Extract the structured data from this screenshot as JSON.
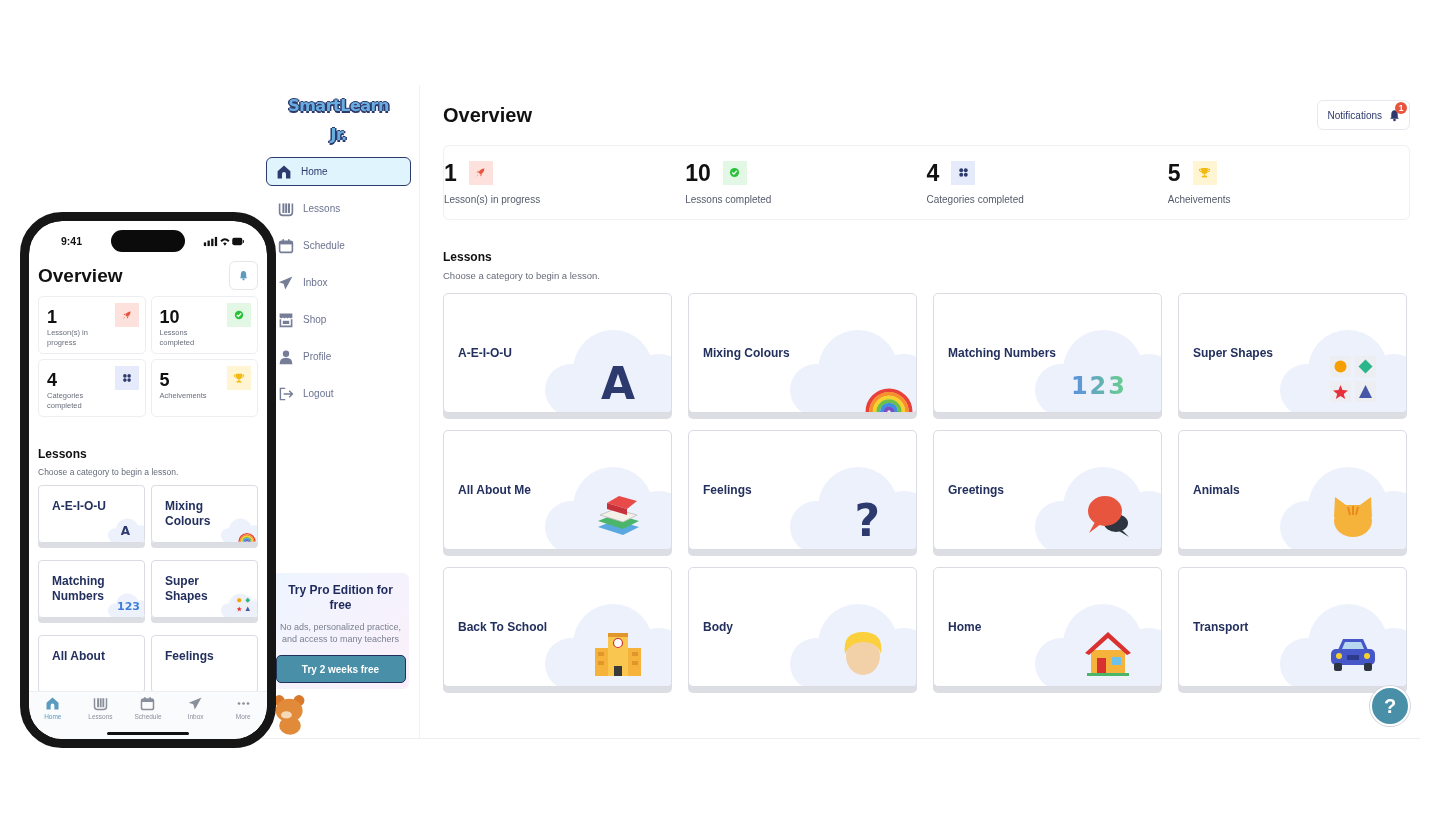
{
  "app": {
    "logo": "SmartLearn Jr.",
    "sidebar": {
      "items": [
        {
          "label": "Home",
          "kind": "home",
          "selected": true
        },
        {
          "label": "Lessons",
          "kind": "book",
          "selected": false
        },
        {
          "label": "Schedule",
          "kind": "calendar",
          "selected": false
        },
        {
          "label": "Inbox",
          "kind": "plane",
          "selected": false
        },
        {
          "label": "Shop",
          "kind": "shop",
          "selected": false
        },
        {
          "label": "Profile",
          "kind": "person",
          "selected": false
        },
        {
          "label": "Logout",
          "kind": "logout",
          "selected": false
        }
      ]
    },
    "promo": {
      "title": "Try Pro Edition for free",
      "text": "No ads, personalized practice, and access to many teachers",
      "button": "Try 2 weeks free"
    },
    "title": "Overview",
    "notifications": {
      "label": "Notifications",
      "badge": "1"
    },
    "stats": [
      {
        "value": "1",
        "label": "Lesson(s) in progress",
        "kind": "rocket"
      },
      {
        "value": "10",
        "label": "Lessons completed",
        "kind": "check"
      },
      {
        "value": "4",
        "label": "Categories completed",
        "kind": "grid"
      },
      {
        "value": "5",
        "label": "Acheivements",
        "kind": "trophy"
      }
    ],
    "lessons": {
      "heading": "Lessons",
      "subtitle": "Choose a category to begin a lesson.",
      "cards": [
        {
          "title": "A-E-I-O-U",
          "kind": "letter",
          "glyph": "A"
        },
        {
          "title": "Mixing Colours",
          "kind": "rainbow"
        },
        {
          "title": "Matching Numbers",
          "kind": "numbers",
          "glyph": "123"
        },
        {
          "title": "Super Shapes",
          "kind": "shapes"
        },
        {
          "title": "All About Me",
          "kind": "books"
        },
        {
          "title": "Feelings",
          "kind": "question",
          "glyph": "?"
        },
        {
          "title": "Greetings",
          "kind": "speech"
        },
        {
          "title": "Animals",
          "kind": "cat"
        },
        {
          "title": "Back To School",
          "kind": "school"
        },
        {
          "title": "Body",
          "kind": "person"
        },
        {
          "title": "Home",
          "kind": "house"
        },
        {
          "title": "Transport",
          "kind": "car"
        }
      ]
    },
    "help_button": "?"
  },
  "phone": {
    "time": "9:41",
    "title": "Overview",
    "stats": [
      {
        "value": "1",
        "label": "Lesson(s) in progress",
        "kind": "rocket"
      },
      {
        "value": "10",
        "label": "Lessons completed",
        "kind": "check"
      },
      {
        "value": "4",
        "label": "Categories completed",
        "kind": "grid"
      },
      {
        "value": "5",
        "label": "Acheivements",
        "kind": "trophy"
      }
    ],
    "lessons_heading": "Lessons",
    "lessons_subtitle": "Choose a category to begin a lesson.",
    "lessons": [
      {
        "title": "A-E-I-O-U",
        "kind": "letter",
        "glyph": "A"
      },
      {
        "title": "Mixing Colours",
        "kind": "rainbow"
      },
      {
        "title": "Matching Numbers",
        "kind": "numbers",
        "glyph": "123"
      },
      {
        "title": "Super Shapes",
        "kind": "shapes"
      },
      {
        "title": "All About"
      },
      {
        "title": "Feelings"
      }
    ],
    "tab_bar": [
      {
        "label": "Home",
        "kind": "home",
        "selected": true
      },
      {
        "label": "Lessons",
        "kind": "book",
        "selected": false
      },
      {
        "label": "Schedule",
        "kind": "calendar",
        "selected": false
      },
      {
        "label": "Inbox",
        "kind": "plane",
        "selected": false
      },
      {
        "label": "More",
        "kind": "dots",
        "selected": false
      }
    ]
  }
}
